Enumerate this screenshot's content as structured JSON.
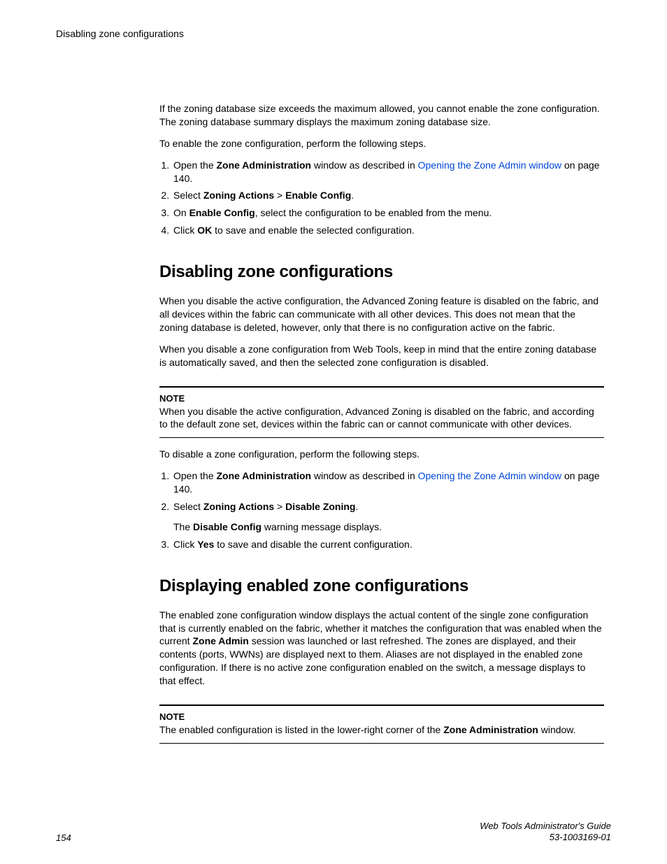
{
  "header": {
    "title": "Disabling zone configurations"
  },
  "intro": {
    "p1": "If the zoning database size exceeds the maximum allowed, you cannot enable the zone configuration. The zoning database summary displays the maximum zoning database size.",
    "p2": "To enable the zone configuration, perform the following steps."
  },
  "steps1": {
    "s1_pre": "Open the ",
    "s1_bold": "Zone Administration",
    "s1_mid": " window as described in ",
    "s1_link": "Opening the Zone Admin window",
    "s1_post": " on page 140.",
    "s2_pre": "Select ",
    "s2_bold1": "Zoning Actions",
    "s2_sep": "  > ",
    "s2_bold2": "Enable Config",
    "s2_post": ".",
    "s3_pre": "On ",
    "s3_bold": "Enable Config",
    "s3_post": ", select the configuration to be enabled from the menu.",
    "s4_pre": "Click ",
    "s4_bold": "OK",
    "s4_post": " to save and enable the selected configuration."
  },
  "sec1": {
    "heading": "Disabling zone configurations",
    "p1": "When you disable the active configuration, the Advanced Zoning feature is disabled on the fabric, and all devices within the fabric can communicate with all other devices. This does not mean that the zoning database is deleted, however, only that there is no configuration active on the fabric.",
    "p2": "When you disable a zone configuration from Web Tools, keep in mind that the entire zoning database is automatically saved, and then the selected zone configuration is disabled.",
    "note_label": "NOTE",
    "note_body": "When you disable the active configuration, Advanced Zoning is disabled on the fabric, and according to the default zone set, devices within the fabric can or cannot communicate with other devices.",
    "p3": "To disable a zone configuration, perform the following steps."
  },
  "steps2": {
    "s1_pre": "Open the ",
    "s1_bold": "Zone Administration",
    "s1_mid": " window as described in ",
    "s1_link": "Opening the Zone Admin window",
    "s1_post": " on page 140.",
    "s2_pre": "Select ",
    "s2_bold1": "Zoning Actions",
    "s2_sep": "  > ",
    "s2_bold2": "Disable Zoning",
    "s2_post": ".",
    "s2_sub_pre": "The ",
    "s2_sub_bold": "Disable Config",
    "s2_sub_post": " warning message displays.",
    "s3_pre": "Click ",
    "s3_bold": "Yes",
    "s3_post": " to save and disable the current configuration."
  },
  "sec2": {
    "heading": "Displaying enabled zone configurations",
    "p1_pre": "The enabled zone configuration window displays the actual content of the single zone configuration that is currently enabled on the fabric, whether it matches the configuration that was enabled when the current ",
    "p1_bold": "Zone Admin",
    "p1_post": " session was launched or last refreshed. The zones are displayed, and their contents (ports, WWNs) are displayed next to them. Aliases are not displayed in the enabled zone configuration. If there is no active zone configuration enabled on the switch, a message displays to that effect.",
    "note_label": "NOTE",
    "note_pre": "The enabled configuration is listed in the lower-right corner of the ",
    "note_bold": "Zone Administration",
    "note_post": " window."
  },
  "footer": {
    "page": "154",
    "title": "Web Tools Administrator's Guide",
    "code": "53-1003169-01"
  }
}
